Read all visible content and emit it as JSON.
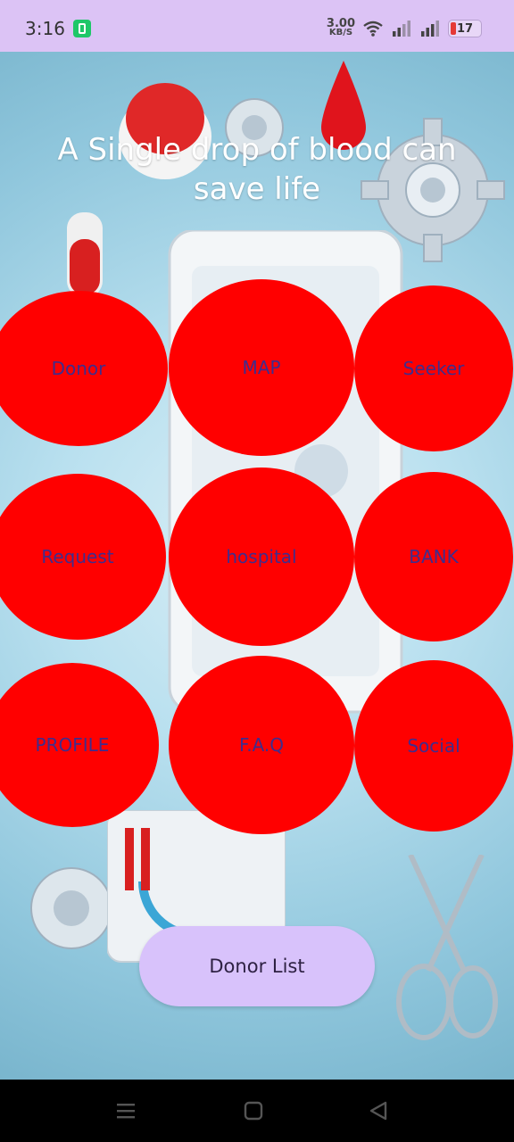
{
  "status_bar": {
    "time": "3:16",
    "net_speed_value": "3.00",
    "net_speed_unit": "KB/S",
    "battery_level": "17",
    "background_color": "#dcc3f5"
  },
  "main": {
    "tagline": "A Single drop of blood can save life",
    "buttons": [
      {
        "label": "Donor"
      },
      {
        "label": "MAP"
      },
      {
        "label": "Seeker"
      },
      {
        "label": "Request"
      },
      {
        "label": "hospital"
      },
      {
        "label": "BANK"
      },
      {
        "label": "PROFILE"
      },
      {
        "label": "F.A.Q"
      },
      {
        "label": "Social"
      }
    ],
    "button_color": "#ff0000",
    "button_text_color": "#3f2d8d",
    "donor_list_label": "Donor List",
    "donor_list_color": "#d8c2fb"
  },
  "nav_bar": {
    "icons": [
      "menu-icon",
      "home-icon",
      "back-icon"
    ]
  }
}
